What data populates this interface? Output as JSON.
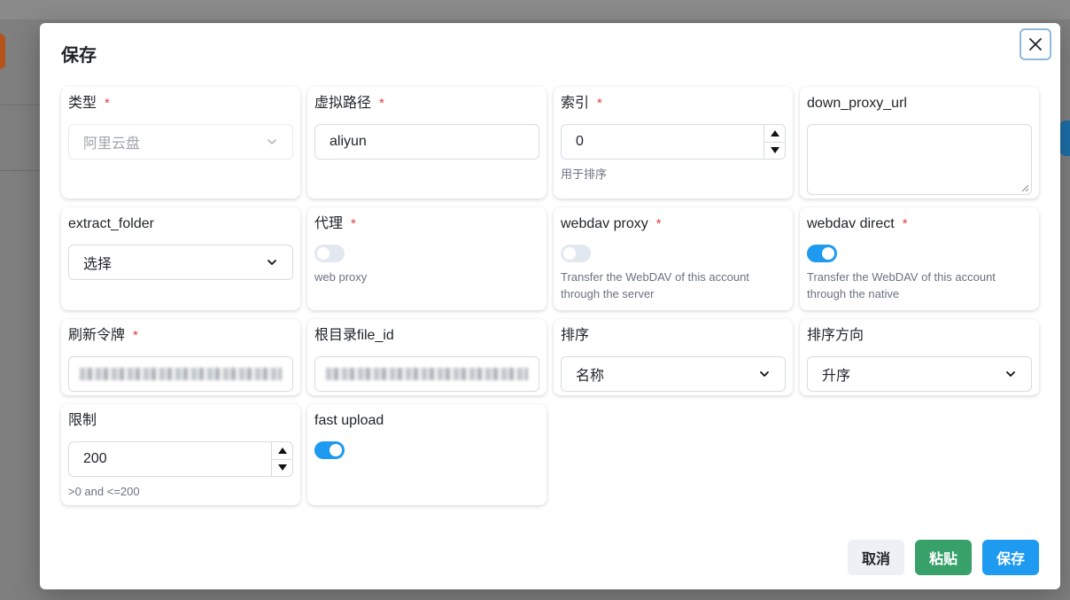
{
  "modal": {
    "title": "保存"
  },
  "fields": {
    "type": {
      "label": "类型",
      "value": "阿里云盘"
    },
    "mount_path": {
      "label": "虚拟路径",
      "value": "aliyun"
    },
    "index": {
      "label": "索引",
      "value": "0",
      "help": "用于排序"
    },
    "down_proxy_url": {
      "label": "down_proxy_url",
      "value": ""
    },
    "extract_folder": {
      "label": "extract_folder",
      "value": "选择"
    },
    "proxy": {
      "label": "代理",
      "enabled": false,
      "help": "web proxy"
    },
    "webdav_proxy": {
      "label": "webdav proxy",
      "enabled": false,
      "help": "Transfer the WebDAV of this account through the server"
    },
    "webdav_direct": {
      "label": "webdav direct",
      "enabled": true,
      "help": "Transfer the WebDAV of this account through the native"
    },
    "refresh_token": {
      "label": "刷新令牌"
    },
    "root_folder_id": {
      "label": "根目录file_id"
    },
    "order_by": {
      "label": "排序",
      "value": "名称"
    },
    "order_direction": {
      "label": "排序方向",
      "value": "升序"
    },
    "limit": {
      "label": "限制",
      "value": "200",
      "help": ">0 and <=200"
    },
    "fast_upload": {
      "label": "fast upload",
      "enabled": true
    }
  },
  "required_mark": "*",
  "buttons": {
    "cancel": "取消",
    "paste": "粘贴",
    "save": "保存"
  },
  "colors": {
    "primary": "#1e9af0",
    "success": "#38a169",
    "required": "#e53e3e"
  },
  "icons": {
    "close": "close-icon",
    "dropdown": "chevron-down-icon",
    "step_up": "caret-up-icon",
    "step_down": "caret-down-icon"
  }
}
